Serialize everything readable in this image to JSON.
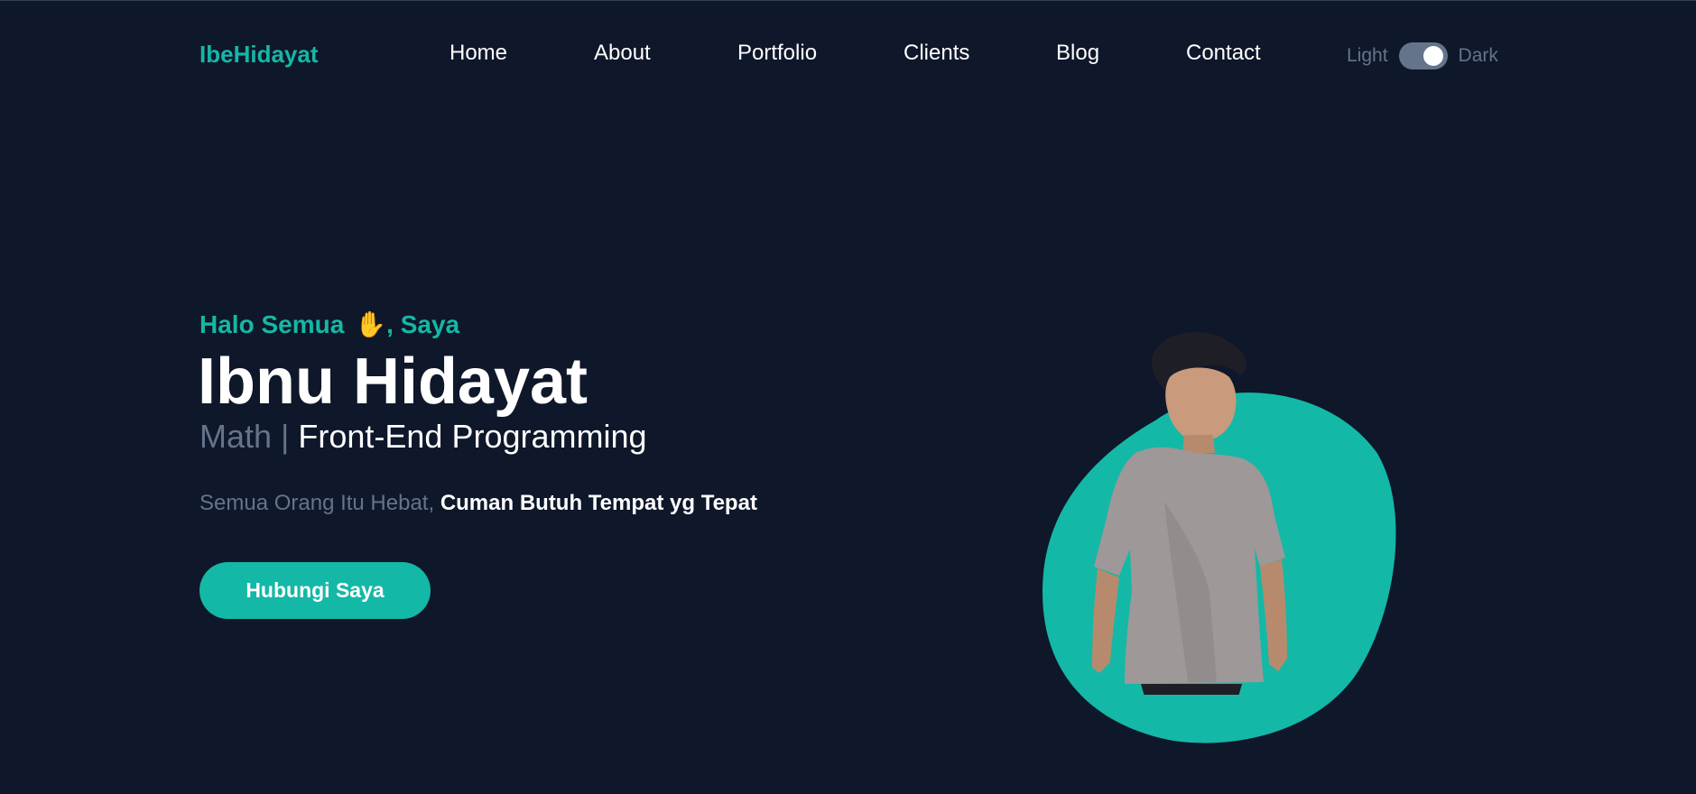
{
  "brand": {
    "logo": "IbeHidayat"
  },
  "nav": {
    "items": [
      {
        "label": "Home"
      },
      {
        "label": "About"
      },
      {
        "label": "Portfolio"
      },
      {
        "label": "Clients"
      },
      {
        "label": "Blog"
      },
      {
        "label": "Contact"
      }
    ]
  },
  "theme": {
    "light_label": "Light",
    "dark_label": "Dark",
    "is_dark": true
  },
  "hero": {
    "greeting": "Halo Semua",
    "greeting_icon": "waving-hand",
    "greeting_suffix": ", Saya",
    "name": "Ibnu Hidayat",
    "role_prefix": "Math | ",
    "role": "Front-End Programming",
    "tagline_muted": "Semua Orang Itu Hebat, ",
    "tagline_strong": "Cuman Butuh Tempat yg Tepat",
    "cta_label": "Hubungi Saya"
  },
  "colors": {
    "background": "#0f172a",
    "accent": "#14b8a6",
    "muted": "#64748b",
    "text": "#ffffff"
  }
}
